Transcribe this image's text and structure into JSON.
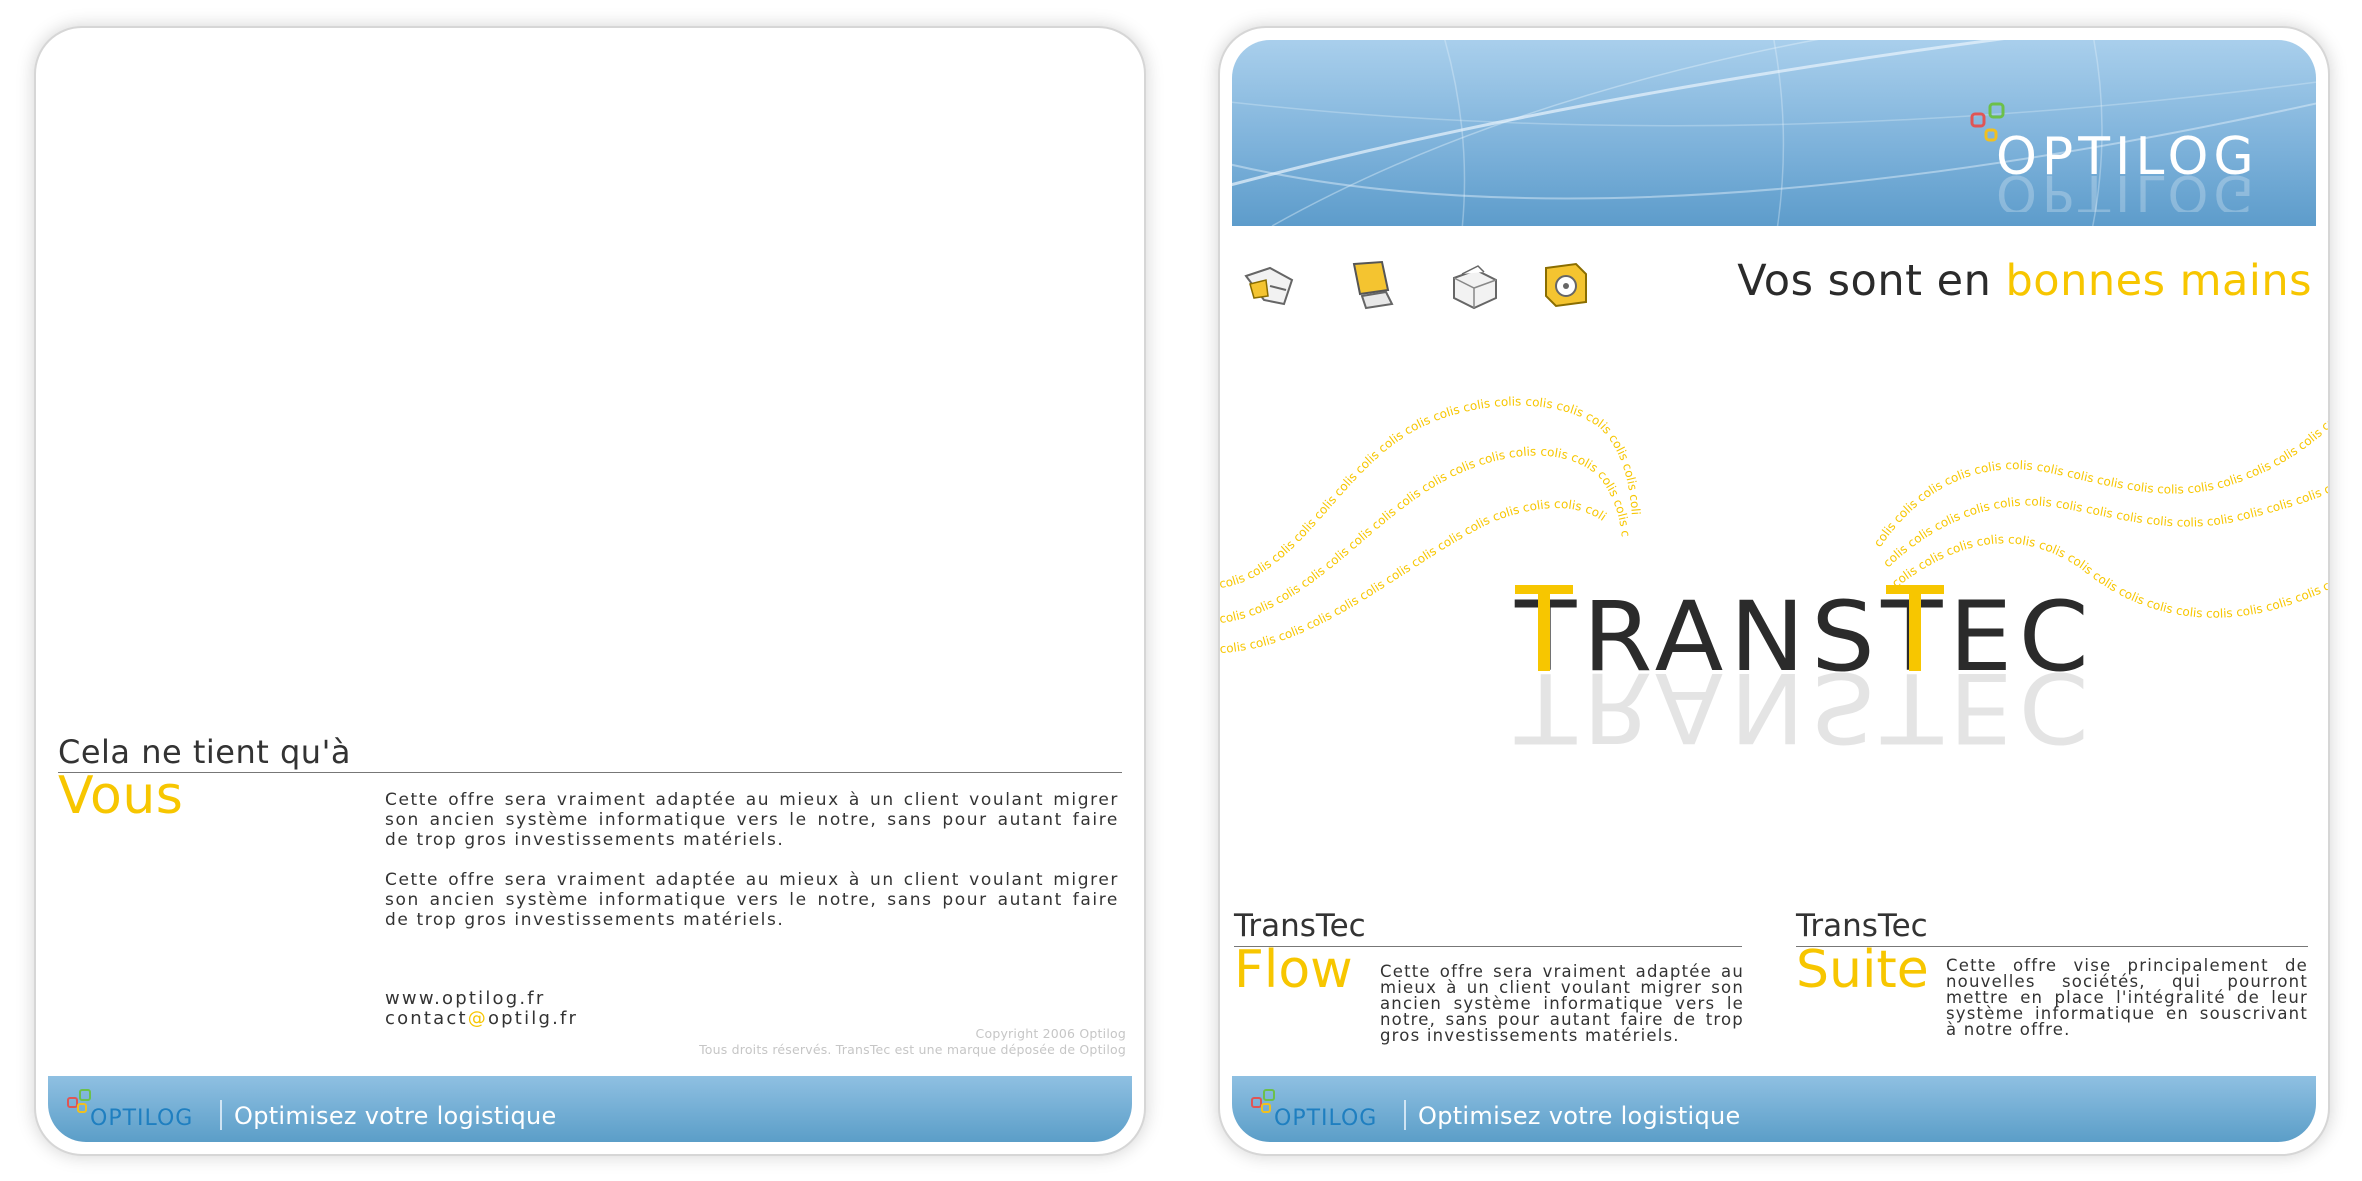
{
  "brand": {
    "logo_text": "OPTILOG",
    "slogan": "Optimisez votre logistique",
    "colors": {
      "accent": "#f7c600",
      "blue": "#5d9ccb",
      "text": "#333333"
    }
  },
  "left_panel": {
    "heading_small": "Cela ne tient qu'à",
    "heading_big": "Vous",
    "paragraphs": [
      "Cette offre sera vraiment adaptée au mieux à un client voulant migrer son ancien système informatique vers le notre, sans pour autant faire de trop gros investissements matériels.",
      "Cette offre sera vraiment adaptée au mieux à un client voulant migrer son ancien système informatique vers le notre, sans pour autant faire de trop gros investissements matériels."
    ],
    "website": "www.optilog.fr",
    "email_user": "contact",
    "email_at": "@",
    "email_domain": "optilg.fr",
    "copyright": "Copyright 2006 Optilog",
    "rights": "Tous droits réservés. TransTec est une marque déposée de Optilog"
  },
  "right_panel": {
    "icons": [
      "scanner-icon",
      "monitor-icon",
      "printer-icon",
      "safe-icon"
    ],
    "tagline_start": "Vos sont en ",
    "tagline_highlight": "bonnes mains",
    "product_logo": "TRANSTEC",
    "wave_word": "colis",
    "columns": [
      {
        "title": "TransTec",
        "name": "Flow",
        "text": "Cette offre sera vraiment adaptée au mieux à un client voulant migrer son ancien système informatique vers le notre, sans pour autant faire de trop gros investissements matériels."
      },
      {
        "title": "TransTec",
        "name": "Suite",
        "text": "Cette offre vise principalement de nouvelles sociétés, qui pourront mettre en place l'intégralité de leur système informatique en souscrivant à notre offre."
      }
    ]
  }
}
